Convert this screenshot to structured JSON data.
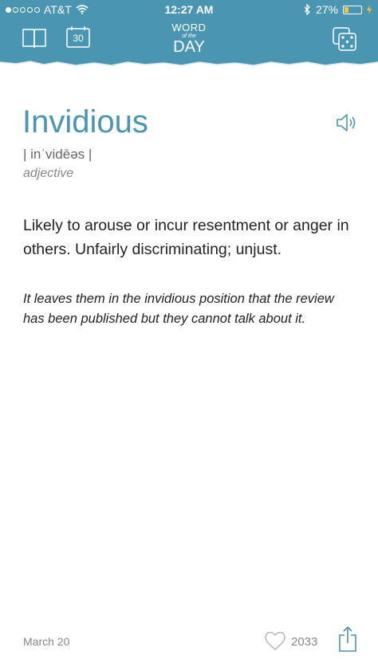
{
  "status_bar": {
    "carrier": "AT&T",
    "time": "12:27 AM",
    "battery_percent": "27%",
    "signal_bars": 1,
    "signal_total": 5,
    "battery_level": 0.27,
    "battery_color": "#f6c23e"
  },
  "header": {
    "logo_line1": "WORD",
    "logo_line2": "of the",
    "logo_line3": "DAY",
    "calendar_day": "30",
    "background_color": "#4a96b2",
    "icons": [
      "book-icon",
      "calendar-icon",
      "dice-icon"
    ]
  },
  "entry": {
    "word": "Invidious",
    "pronunciation": "| inˈvidēəs |",
    "part_of_speech": "adjective",
    "definition": "Likely to arouse or incur resentment or anger in others. Unfairly discriminating; unjust.",
    "example": "It leaves them in the invidious position that the review has been published but they cannot talk about it.",
    "accent_color": "#4a96b2",
    "icons": [
      "speaker-icon"
    ]
  },
  "footer": {
    "date": "March 20",
    "likes": "2033",
    "icons": [
      "heart-icon",
      "share-icon"
    ]
  }
}
